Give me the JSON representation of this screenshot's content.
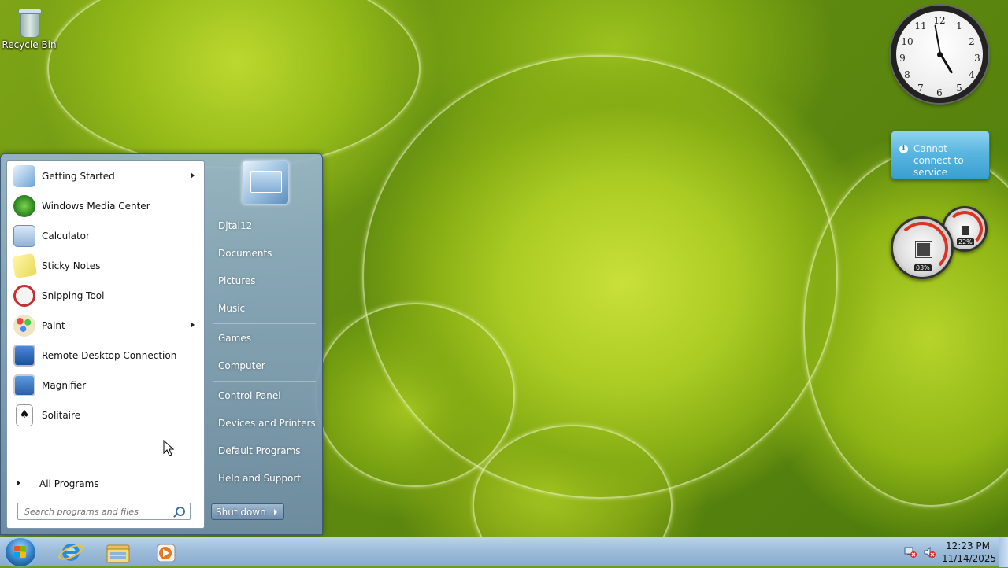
{
  "desktop": {
    "icons": [
      {
        "label": "Recycle Bin"
      }
    ]
  },
  "gadgets": {
    "clock": {
      "numbers": [
        "12",
        "1",
        "2",
        "3",
        "4",
        "5",
        "6",
        "7",
        "8",
        "9",
        "10",
        "11"
      ],
      "time_shown": "4:58"
    },
    "weather": {
      "message": "Cannot connect to service"
    },
    "cpu_meter": {
      "cpu_readout": "03%",
      "memory_readout": "22%"
    }
  },
  "start_menu": {
    "programs": [
      {
        "label": "Getting Started",
        "has_submenu": true,
        "icon": "getting-started-icon"
      },
      {
        "label": "Windows Media Center",
        "has_submenu": false,
        "icon": "media-center-icon"
      },
      {
        "label": "Calculator",
        "has_submenu": false,
        "icon": "calculator-icon"
      },
      {
        "label": "Sticky Notes",
        "has_submenu": false,
        "icon": "sticky-notes-icon"
      },
      {
        "label": "Snipping Tool",
        "has_submenu": false,
        "icon": "snipping-tool-icon"
      },
      {
        "label": "Paint",
        "has_submenu": true,
        "icon": "paint-icon"
      },
      {
        "label": "Remote Desktop Connection",
        "has_submenu": false,
        "icon": "remote-desktop-icon"
      },
      {
        "label": "Magnifier",
        "has_submenu": false,
        "icon": "magnifier-icon"
      },
      {
        "label": "Solitaire",
        "has_submenu": false,
        "icon": "solitaire-icon"
      }
    ],
    "all_programs_label": "All Programs",
    "search": {
      "placeholder": "Search programs and files"
    },
    "right_links": [
      "Djtal12",
      "Documents",
      "Pictures",
      "Music",
      "Games",
      "Computer",
      "Control Panel",
      "Devices and Printers",
      "Default Programs",
      "Help and Support"
    ],
    "shutdown_label": "Shut down"
  },
  "taskbar": {
    "pinned": [
      "internet-explorer-icon",
      "windows-explorer-icon",
      "media-player-icon"
    ],
    "tray_icons": [
      "network-error-icon",
      "volume-muted-icon"
    ],
    "time": "12:23 PM",
    "date": "11/14/2025"
  },
  "colors": {
    "taskbar": "#9dbcda",
    "start_menu_right": "#7e9cba",
    "wallpaper_green": "#aacb23"
  }
}
